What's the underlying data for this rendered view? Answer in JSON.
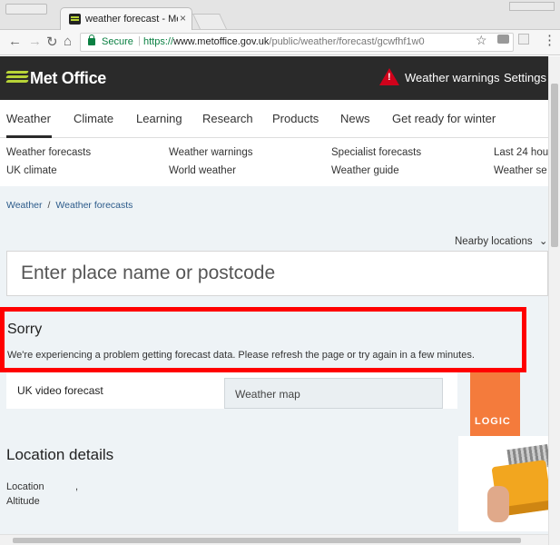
{
  "browser": {
    "tab_title": "weather forecast - Met",
    "tab_close": "×",
    "secure_label": "Secure",
    "url_proto": "https://",
    "url_host": "www.metoffice.gov.uk",
    "url_path": "/public/weather/forecast/gcwfhf1w0"
  },
  "header": {
    "logo": "Met Office",
    "links": [
      "Weather warnings",
      "Settings"
    ]
  },
  "mainnav": [
    "Weather",
    "Climate",
    "Learning",
    "Research",
    "Products",
    "News",
    "Get ready for winter"
  ],
  "subnav": [
    [
      "Weather forecasts",
      "Weather warnings",
      "Specialist forecasts",
      "Last 24 hou"
    ],
    [
      "UK climate",
      "World weather",
      "Weather guide",
      "Weather se"
    ]
  ],
  "breadcrumb": [
    "Weather",
    "Weather forecasts"
  ],
  "nearby": "Nearby locations",
  "search": {
    "placeholder": "Enter place name or postcode"
  },
  "error": {
    "title": "Sorry",
    "message": "We're experiencing a problem getting forecast data. Please refresh the page or try again in a few minutes."
  },
  "tiles": {
    "video": "UK video forecast",
    "map": "Weather map"
  },
  "ad": {
    "brand": "LOGIC"
  },
  "location": {
    "title": "Location details",
    "location_label": "Location",
    "location_value": ",",
    "altitude_label": "Altitude"
  },
  "colors": {
    "header_bg": "#2a2a2a",
    "brand_green": "#b7d337",
    "warning_red": "#d0021b",
    "error_border": "#ff0000",
    "content_bg": "#eef3f6"
  }
}
